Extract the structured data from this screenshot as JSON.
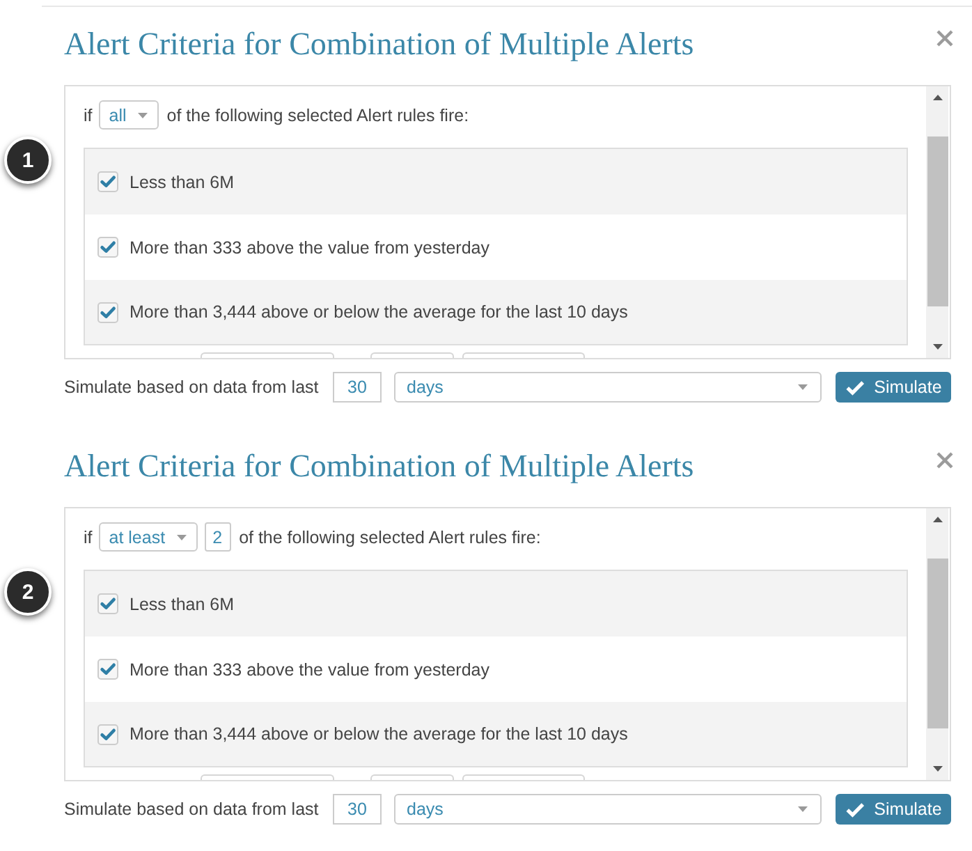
{
  "panels": [
    {
      "badge": "1",
      "title": "Alert Criteria for Combination of Multiple Alerts",
      "condition": {
        "prefix": "if",
        "quantifier": "all",
        "suffix": "of the following selected Alert rules fire:"
      },
      "rules": [
        {
          "label": "Less than 6M",
          "checked": true
        },
        {
          "label": "More than 333 above the value from yesterday",
          "checked": true
        },
        {
          "label": "More than 3,444 above or below the average for the last 10 days",
          "checked": true
        }
      ],
      "simulate": {
        "label": "Simulate based on data from last",
        "amount": "30",
        "unit": "days",
        "button": "Simulate"
      }
    },
    {
      "badge": "2",
      "title": "Alert Criteria for Combination of Multiple Alerts",
      "condition": {
        "prefix": "if",
        "quantifier": "at least",
        "count": "2",
        "suffix": "of the following selected Alert rules fire:"
      },
      "rules": [
        {
          "label": "Less than 6M",
          "checked": true
        },
        {
          "label": "More than 333 above the value from yesterday",
          "checked": true
        },
        {
          "label": "More than 3,444 above or below the average for the last 10 days",
          "checked": true
        }
      ],
      "simulate": {
        "label": "Simulate based on data from last",
        "amount": "30",
        "unit": "days",
        "button": "Simulate"
      }
    }
  ]
}
